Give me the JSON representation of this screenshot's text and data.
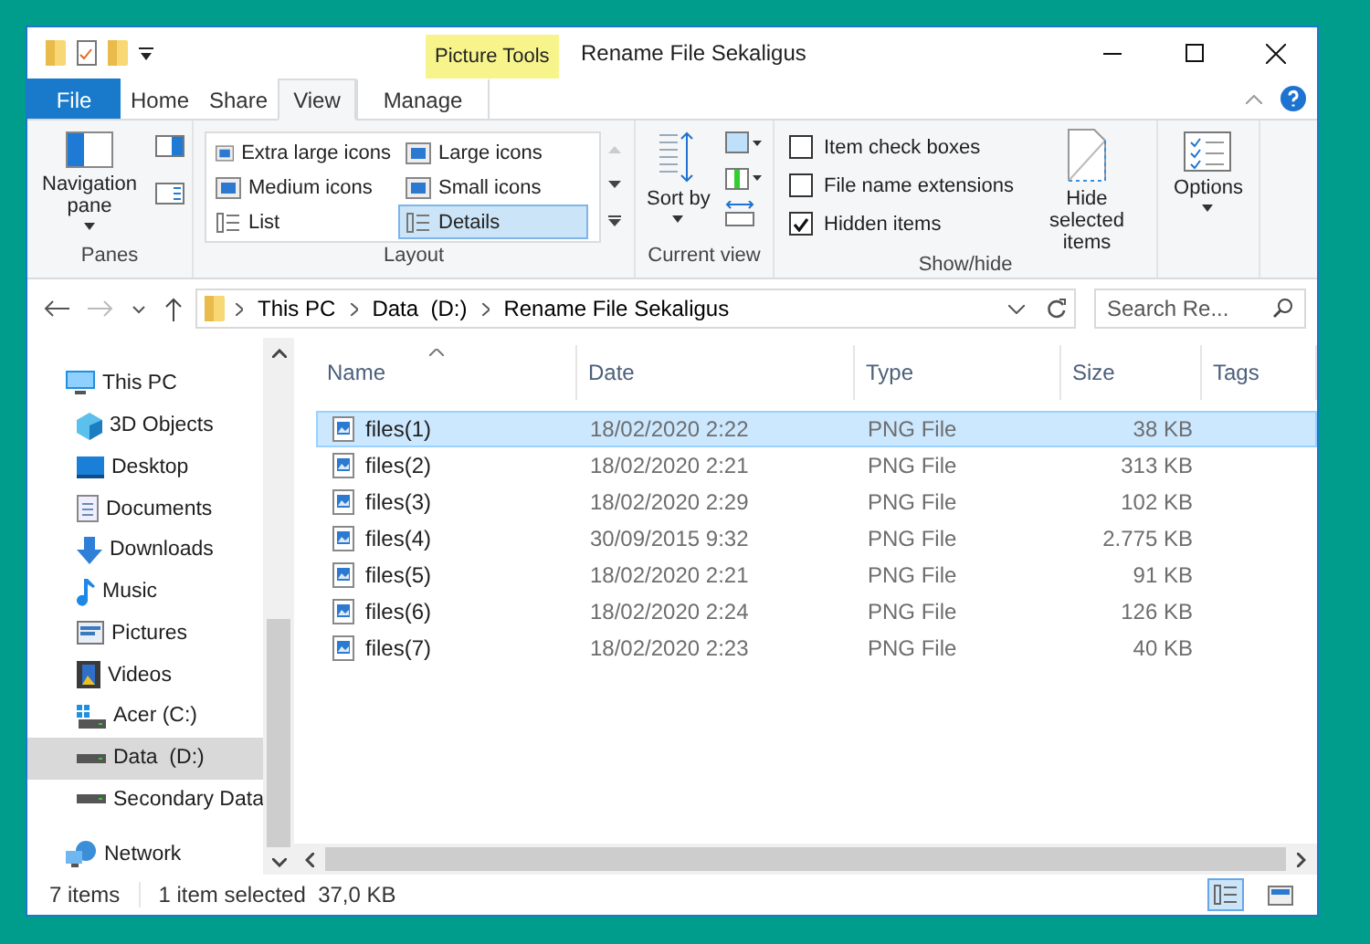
{
  "window": {
    "title": "Rename File Sekaligus"
  },
  "contextual_group": "Picture Tools",
  "ribbon_tabs": [
    {
      "label": "File",
      "kind": "file",
      "selected": false
    },
    {
      "label": "Home",
      "kind": "tab",
      "selected": false
    },
    {
      "label": "Share",
      "kind": "tab",
      "selected": false
    },
    {
      "label": "View",
      "kind": "tab",
      "selected": true
    },
    {
      "label": "Manage",
      "kind": "contextual",
      "selected": false
    }
  ],
  "panes": {
    "label": "Panes",
    "navigation_pane": "Navigation pane"
  },
  "layout": {
    "label": "Layout",
    "options": [
      {
        "label": "Extra large icons",
        "selected": false
      },
      {
        "label": "Large icons",
        "selected": false
      },
      {
        "label": "Medium icons",
        "selected": false
      },
      {
        "label": "Small icons",
        "selected": false
      },
      {
        "label": "List",
        "selected": false
      },
      {
        "label": "Details",
        "selected": true
      }
    ]
  },
  "current_view": {
    "label": "Current view",
    "sort_by": "Sort by"
  },
  "show_hide": {
    "label": "Show/hide",
    "checkboxes": [
      {
        "label": "Item check boxes",
        "checked": false
      },
      {
        "label": "File name extensions",
        "checked": false
      },
      {
        "label": "Hidden items",
        "checked": true
      }
    ],
    "hide_selected": "Hide selected items"
  },
  "options": "Options",
  "address": {
    "breadcrumbs": [
      "This PC",
      "Data  (D:)",
      "Rename File Sekaligus"
    ]
  },
  "search": {
    "placeholder": "Search Re..."
  },
  "nav": [
    {
      "label": "This PC",
      "kind": "pc",
      "selected": false,
      "children": [
        {
          "label": "3D Objects",
          "kind": "cube",
          "selected": false
        },
        {
          "label": "Desktop",
          "kind": "desktop",
          "selected": false
        },
        {
          "label": "Documents",
          "kind": "documents",
          "selected": false
        },
        {
          "label": "Downloads",
          "kind": "downloads",
          "selected": false
        },
        {
          "label": "Music",
          "kind": "music",
          "selected": false
        },
        {
          "label": "Pictures",
          "kind": "pictures",
          "selected": false
        },
        {
          "label": "Videos",
          "kind": "videos",
          "selected": false
        },
        {
          "label": "Acer (C:)",
          "kind": "osdrive",
          "selected": false
        },
        {
          "label": "Data  (D:)",
          "kind": "drive",
          "selected": true
        },
        {
          "label": "Secondary Data",
          "kind": "drive",
          "selected": false
        }
      ]
    },
    {
      "label": "Network",
      "kind": "network",
      "selected": false
    }
  ],
  "columns": [
    "Name",
    "Date",
    "Type",
    "Size",
    "Tags"
  ],
  "rows": [
    {
      "name": "files(1)",
      "date": "18/02/2020 2:22",
      "type": "PNG File",
      "size": "38 KB",
      "selected": true
    },
    {
      "name": "files(2)",
      "date": "18/02/2020 2:21",
      "type": "PNG File",
      "size": "313 KB",
      "selected": false
    },
    {
      "name": "files(3)",
      "date": "18/02/2020 2:29",
      "type": "PNG File",
      "size": "102 KB",
      "selected": false
    },
    {
      "name": "files(4)",
      "date": "30/09/2015 9:32",
      "type": "PNG File",
      "size": "2.775 KB",
      "selected": false
    },
    {
      "name": "files(5)",
      "date": "18/02/2020 2:21",
      "type": "PNG File",
      "size": "91 KB",
      "selected": false
    },
    {
      "name": "files(6)",
      "date": "18/02/2020 2:24",
      "type": "PNG File",
      "size": "126 KB",
      "selected": false
    },
    {
      "name": "files(7)",
      "date": "18/02/2020 2:23",
      "type": "PNG File",
      "size": "40 KB",
      "selected": false
    }
  ],
  "status": {
    "count": "7 items",
    "selection": "1 item selected  37,0 KB"
  }
}
